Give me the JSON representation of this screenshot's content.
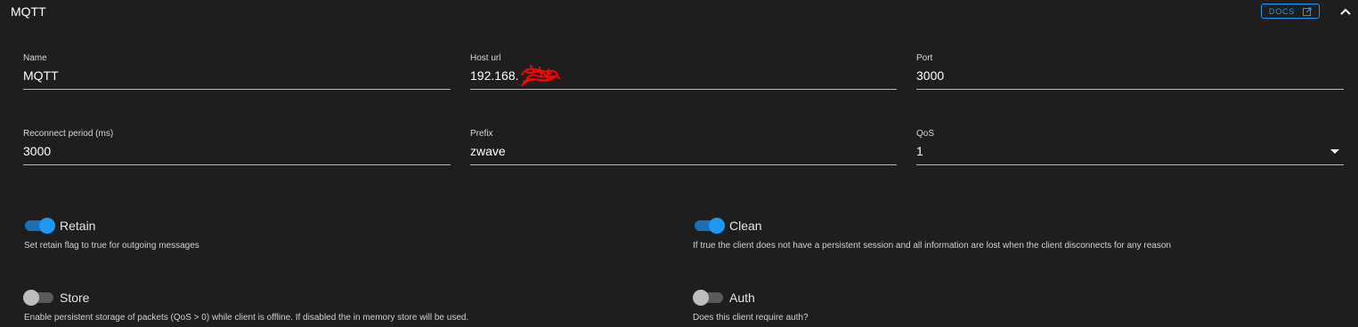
{
  "panel": {
    "title": "MQTT",
    "docs_label": "DOCS"
  },
  "fields": {
    "name": {
      "label": "Name",
      "value": "MQTT"
    },
    "host": {
      "label": "Host url",
      "value": "192.168."
    },
    "port": {
      "label": "Port",
      "value": "3000"
    },
    "reconnect": {
      "label": "Reconnect period (ms)",
      "value": "3000"
    },
    "prefix": {
      "label": "Prefix",
      "value": "zwave"
    },
    "qos": {
      "label": "QoS",
      "value": "1"
    }
  },
  "switches": {
    "retain": {
      "label": "Retain",
      "on": true,
      "hint": "Set retain flag to true for outgoing messages"
    },
    "clean": {
      "label": "Clean",
      "on": true,
      "hint": "If true the client does not have a persistent session and all information are lost when the client disconnects for any reason"
    },
    "store": {
      "label": "Store",
      "on": false,
      "hint": "Enable persistent storage of packets (QoS > 0) while client is offline. If disabled the in memory store will be used."
    },
    "auth": {
      "label": "Auth",
      "on": false,
      "hint": "Does this client require auth?"
    }
  },
  "colors": {
    "accent": "#2196f3",
    "background": "#1e1e1e",
    "redaction": "#ff0000"
  },
  "icons": {
    "docs": "open-in-new-icon",
    "collapse": "chevron-up-icon",
    "select": "caret-down-icon"
  }
}
